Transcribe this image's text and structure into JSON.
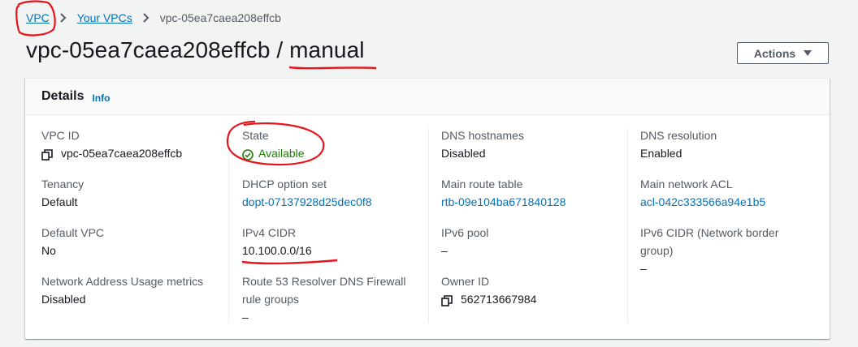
{
  "breadcrumb": {
    "items": [
      "VPC",
      "Your VPCs"
    ],
    "current": "vpc-05ea7caea208effcb"
  },
  "page": {
    "title": "vpc-05ea7caea208effcb / manual",
    "actions_label": "Actions"
  },
  "details": {
    "heading": "Details",
    "info_label": "Info",
    "fields": {
      "vpc_id": {
        "label": "VPC ID",
        "value": "vpc-05ea7caea208effcb"
      },
      "state": {
        "label": "State",
        "value": "Available"
      },
      "dns_hostnames": {
        "label": "DNS hostnames",
        "value": "Disabled"
      },
      "dns_resolution": {
        "label": "DNS resolution",
        "value": "Enabled"
      },
      "tenancy": {
        "label": "Tenancy",
        "value": "Default"
      },
      "dhcp_option_set": {
        "label": "DHCP option set",
        "value": "dopt-07137928d25dec0f8"
      },
      "main_route_table": {
        "label": "Main route table",
        "value": "rtb-09e104ba671840128"
      },
      "main_network_acl": {
        "label": "Main network ACL",
        "value": "acl-042c333566a94e1b5"
      },
      "default_vpc": {
        "label": "Default VPC",
        "value": "No"
      },
      "ipv4_cidr": {
        "label": "IPv4 CIDR",
        "value": "10.100.0.0/16"
      },
      "ipv6_pool": {
        "label": "IPv6 pool",
        "value": "–"
      },
      "ipv6_cidr": {
        "label": "IPv6 CIDR (Network border group)",
        "value": "–"
      },
      "nau_metrics": {
        "label": "Network Address Usage metrics",
        "value": "Disabled"
      },
      "route53": {
        "label": "Route 53 Resolver DNS Firewall rule groups",
        "value": "–"
      },
      "owner_id": {
        "label": "Owner ID",
        "value": "562713667984"
      }
    }
  },
  "colors": {
    "link": "#0073bb",
    "success": "#1d8102",
    "annotation": "#e8141b"
  }
}
